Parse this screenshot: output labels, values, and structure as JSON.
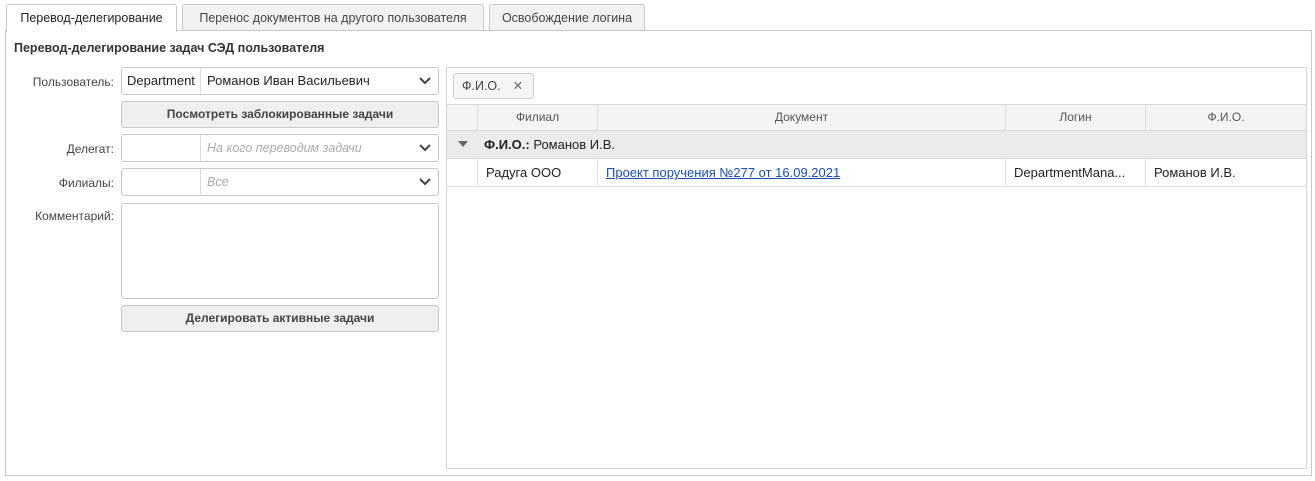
{
  "tabs": [
    {
      "label": "Перевод-делегирование",
      "active": true
    },
    {
      "label": "Перенос документов на другого пользователя",
      "active": false
    },
    {
      "label": "Освобождение логина",
      "active": false
    }
  ],
  "form": {
    "title": "Перевод-делегирование задач СЭД пользователя",
    "user": {
      "label": "Пользователь:",
      "department_value": "Department",
      "name_value": "Романов Иван Васильевич"
    },
    "view_blocked_button": "Посмотреть заблокированные задачи",
    "delegate": {
      "label": "Делегат:",
      "left_value": "",
      "placeholder": "На кого переводим задачи"
    },
    "branches": {
      "label": "Филиалы:",
      "left_value": "",
      "placeholder": "Все"
    },
    "comment": {
      "label": "Комментарий:",
      "value": ""
    },
    "delegate_button": "Делегировать активные задачи"
  },
  "grid": {
    "group_chip": {
      "label": "Ф.И.О.",
      "remove_icon": "close-icon"
    },
    "columns": [
      "Филиал",
      "Документ",
      "Логин",
      "Ф.И.О."
    ],
    "group_row": {
      "field": "Ф.И.О.:",
      "value": "Романов И.В."
    },
    "rows": [
      {
        "branch": "Радуга ООО",
        "document": "Проект поручения №277 от 16.09.2021",
        "login": "DepartmentMana...",
        "fio": "Романов И.В."
      }
    ]
  },
  "colors": {
    "link": "#1a4fb3",
    "border": "#c8c8c8",
    "header_bg": "#f4f4f4",
    "group_bg": "#ebebeb"
  }
}
